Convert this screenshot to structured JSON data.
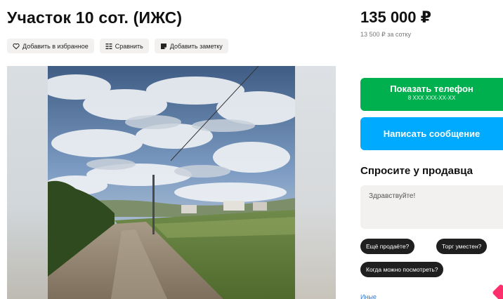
{
  "listing": {
    "title": "Участок 10 сот. (ИЖС)",
    "price": "135 000 ₽",
    "price_per_unit": "13 500 ₽ за сотку"
  },
  "actions": {
    "favorite": "Добавить в избранное",
    "compare": "Сравнить",
    "note": "Добавить заметку"
  },
  "contact": {
    "show_phone": "Показать телефон",
    "phone_mask": "8 XXX XXX-XX-XX",
    "write_message": "Написать сообщение"
  },
  "ask_seller": {
    "title": "Спросите у продавца",
    "message_placeholder": "Здравствуйте!",
    "chips": [
      "Ещё продаёте?",
      "Торг уместен?",
      "Когда можно посмотреть?"
    ],
    "more_link": "Иные"
  },
  "colors": {
    "green": "#00b04f",
    "blue": "#00aaff",
    "chip_bg": "#1f1f1f"
  },
  "icons": {
    "favorite": "heart-icon",
    "compare": "compare-icon",
    "note": "note-icon"
  }
}
